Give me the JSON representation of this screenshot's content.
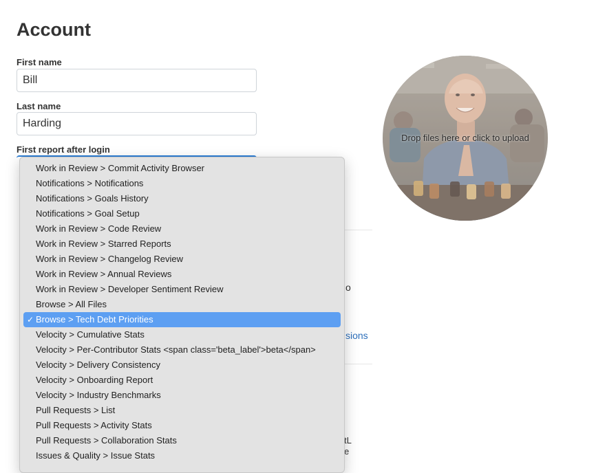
{
  "page": {
    "title": "Account"
  },
  "form": {
    "first_name": {
      "label": "First name",
      "value": "Bill"
    },
    "last_name": {
      "label": "Last name",
      "value": "Harding"
    },
    "first_report": {
      "label": "First report after login"
    }
  },
  "background_fragments": {
    "right_p": "o",
    "link_fragment": "sions",
    "bottom_fragment_1": "tL",
    "bottom_fragment_2": "e"
  },
  "avatar": {
    "dropzone_text": "Drop files here or click to upload"
  },
  "dropdown": {
    "selected_index": 10,
    "options": [
      "Work in Review > Commit Activity Browser",
      "Notifications > Notifications",
      "Notifications > Goals History",
      "Notifications > Goal Setup",
      "Work in Review > Code Review",
      "Work in Review > Starred Reports",
      "Work in Review > Changelog Review",
      "Work in Review > Annual Reviews",
      "Work in Review > Developer Sentiment Review",
      "Browse > All Files",
      "Browse > Tech Debt Priorities",
      "Velocity > Cumulative Stats",
      "Velocity > Per-Contributor Stats <span class='beta_label'>beta</span>",
      "Velocity > Delivery Consistency",
      "Velocity > Onboarding Report",
      "Velocity > Industry Benchmarks",
      "Pull Requests > List",
      "Pull Requests > Activity Stats",
      "Pull Requests > Collaboration Stats",
      "Issues & Quality > Issue Stats"
    ]
  }
}
